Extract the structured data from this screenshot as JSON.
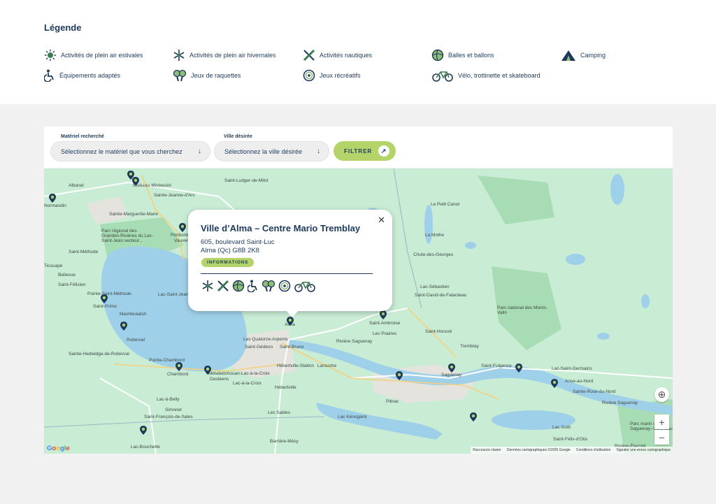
{
  "legend": {
    "title": "Légende",
    "items": [
      {
        "label": "Activités de plein air estivales",
        "icon": "sun-icon"
      },
      {
        "label": "Activités de plein air hivernales",
        "icon": "snowflake-icon"
      },
      {
        "label": "Activités nautiques",
        "icon": "kayak-icon"
      },
      {
        "label": "Balles et ballons",
        "icon": "ball-icon"
      },
      {
        "label": "Camping",
        "icon": "tent-icon"
      },
      {
        "label": "Équipements adaptés",
        "icon": "wheelchair-icon"
      },
      {
        "label": "Jeux de raquettes",
        "icon": "racket-icon"
      },
      {
        "label": "Jeux récréatifs",
        "icon": "target-icon"
      },
      {
        "label": "Vélo, trottinette et skateboard",
        "icon": "bike-icon"
      }
    ]
  },
  "filters": {
    "material_label": "Matériel recherché",
    "material_value": "Sélectionnez le matériel que vous cherchez",
    "city_label": "Ville désirée",
    "city_value": "Sélectionnez la ville désirée",
    "filter_button": "FILTRER"
  },
  "popup": {
    "title": "Ville d’Alma – Centre Mario Tremblay",
    "address_line1": "605, boulevard Saint-Luc",
    "address_line2": "Alma (Qc) G8B 2K8",
    "info_button": "INFORMATIONS",
    "close": "✕",
    "icons": [
      "snowflake-icon",
      "kayak-icon",
      "ball-icon",
      "wheelchair-icon",
      "racket-icon",
      "target-icon",
      "bike-icon"
    ]
  },
  "map": {
    "places": [
      "Albanel",
      "Dolbeau-Mistassini",
      "Sainte-Jeanne-d'Arc",
      "Saint-Ludger-de-Milot",
      "Normandin",
      "Sainte-Marguerite-Marie",
      "Parc régional des Grandes-Rivières du Lac-Saint-Jean secteur...",
      "Vauvert",
      "Péribonka",
      "Saint-Méthode",
      "Ticouapé",
      "Bellevue",
      "Saint-Félicien",
      "Pointe-Saint-Méthode",
      "Saint-Prime",
      "Mashteuiatsh",
      "Roberval",
      "Lac-Saint-Jean",
      "Alma",
      "Saint-Ambroise",
      "Les Prairies",
      "Les Quatorze-Arpents",
      "Saint-Gédéon",
      "Saint-Bruno",
      "Hébertville-Station",
      "Larouche",
      "Rivière Saguenay",
      "Sainte-Hedwidge-de-Roberval",
      "Pointe-Chambord",
      "Chambord",
      "Desbiens",
      "Métabetchouan-Lac-à-la-Croix",
      "Lac-à-la-Croix",
      "Hébertville",
      "Lac-à-Belly",
      "Simonet",
      "Saint-François-de-Sales",
      "Lac-Bouchette",
      "Les Sables",
      "Lac Kénogami",
      "Barrière-Mésy",
      "Le Petit Canot",
      "Chute-des-Georges",
      "Lac-Sébastien",
      "Saint-David-de-Falardeau",
      "Parc national des Monts-Valin",
      "Saint-Honoré",
      "Tremblay",
      "Saguenay",
      "Saint-Fulgence",
      "Lac-Saint-Germains",
      "Anse-au-Nord",
      "Sainte-Rose-du-Nord",
      "Pibrac",
      "Lac Goth",
      "Saint-Félix-d'Otis",
      "Rivière-Éternité",
      "Parc marin du Saguenay–Saint-Laurent",
      "Rivière Saguenay",
      "La Mothe"
    ],
    "zoom_in": "+",
    "zoom_out": "−",
    "google": "Google",
    "attribution": [
      "Raccourcis clavier",
      "Données cartographiques ©2025 Google",
      "Conditions d'utilisation",
      "Signaler une erreur cartographique"
    ]
  },
  "colors": {
    "navy": "#1d3a5c",
    "accent_green": "#b4d46a",
    "land": "#c9ecd5",
    "water": "#9fd0ea"
  }
}
